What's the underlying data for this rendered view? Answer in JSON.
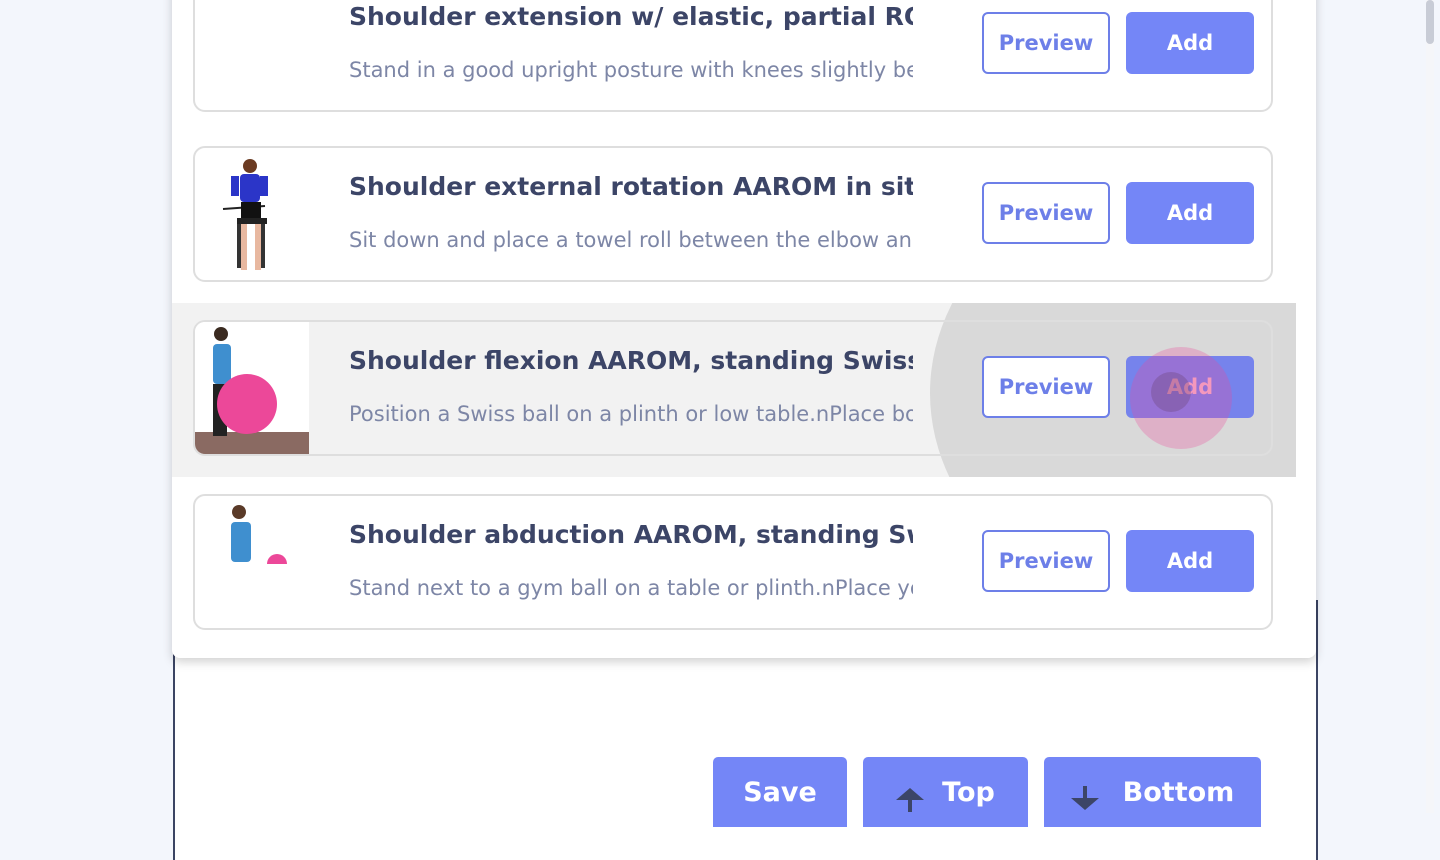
{
  "exercises": [
    {
      "title": "Shoulder extension w/ elastic, partial ROM",
      "description": "Stand in a good upright posture with knees slightly bent.",
      "preview_label": "Preview",
      "add_label": "Add"
    },
    {
      "title": "Shoulder external rotation AAROM in sitting",
      "description": "Sit down and place a towel roll between the elbow and body.",
      "preview_label": "Preview",
      "add_label": "Add"
    },
    {
      "title": "Shoulder flexion AAROM, standing Swiss ball",
      "description": "Position a Swiss ball on a plinth or low table.nPlace both hands on the ball.",
      "preview_label": "Preview",
      "add_label": "Add"
    },
    {
      "title": "Shoulder abduction AAROM, standing Swiss ball",
      "description": "Stand next to a gym ball on a table or plinth.nPlace your hand on the ball.",
      "preview_label": "Preview",
      "add_label": "Add"
    }
  ],
  "toolbar": {
    "save_label": "Save",
    "top_label": "Top",
    "bottom_label": "Bottom"
  },
  "icons": {
    "top": "arrow-up-icon",
    "bottom": "arrow-down-icon"
  },
  "colors": {
    "accent": "#7486f7",
    "title_text": "#3c4567",
    "desc_text": "#7d86a6",
    "ball": "#ec4899"
  }
}
